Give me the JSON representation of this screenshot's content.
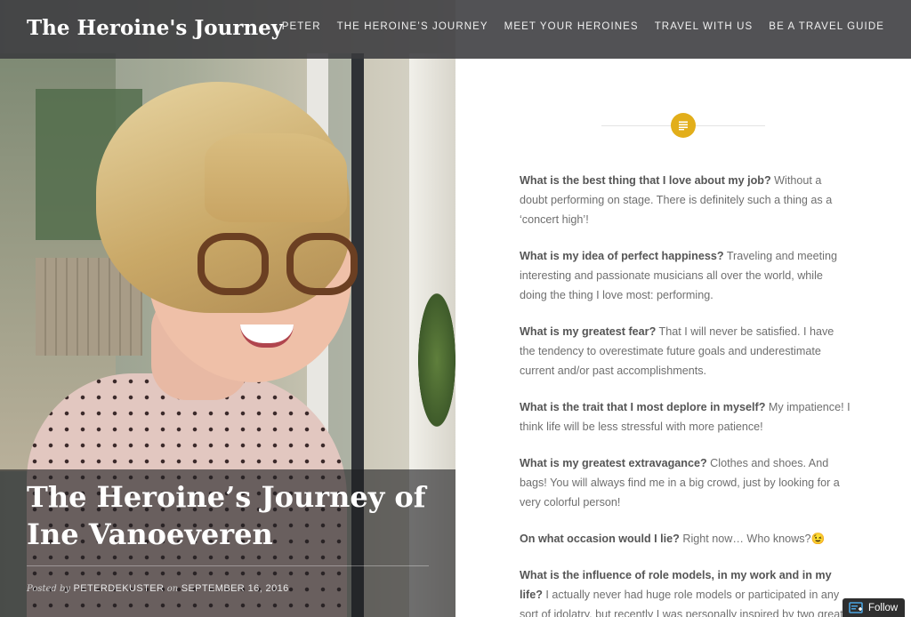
{
  "header": {
    "site_title": "The Heroine's Journey",
    "nav": [
      "PETER",
      "THE HEROINE’S JOURNEY",
      "MEET YOUR HEROINES",
      "TRAVEL WITH US",
      "BE A TRAVEL GUIDE"
    ]
  },
  "hero": {
    "post_title": "The Heroine’s Journey of Ine Vanoeveren",
    "meta": {
      "posted_by_label": "Posted by",
      "author": "PETERDEKUSTER",
      "on_label": "on",
      "date": "SEPTEMBER 16, 2016"
    }
  },
  "content": {
    "format_icon": "document-lines-icon",
    "accent_color": "#e2ae1a",
    "qa": [
      {
        "q": "What is the best thing that I love about my job?",
        "a": " Without a doubt performing on stage. There is definitely such a thing as a ‘concert high’!"
      },
      {
        "q": "What is my idea of perfect happiness?",
        "a": " Traveling and meeting interesting and passionate musicians all over the world, while doing the thing I love most: performing."
      },
      {
        "q": "What is my greatest fear?",
        "a": " That I will never be satisfied. I have the tendency to overestimate future goals and underestimate current and/or past accomplishments."
      },
      {
        "q": "What is the trait that I most deplore in myself?",
        "a": " My impatience! I think life will be less stressful with more patience!"
      },
      {
        "q": "What is my greatest extravagance?",
        "a": " Clothes and shoes. And bags! You will always find me in a big crowd, just by looking for a very colorful person!"
      },
      {
        "q": "On what occasion would I lie?",
        "a": " Right now… Who knows?😉"
      },
      {
        "q": "What is the influence of role models, in my work and in my life?",
        "a": " I actually never had huge role models or participated in any sort of idolatry, but recently I was personally inspired by two great"
      }
    ]
  },
  "follow": {
    "label": "Follow",
    "icon": "follow-icon"
  }
}
